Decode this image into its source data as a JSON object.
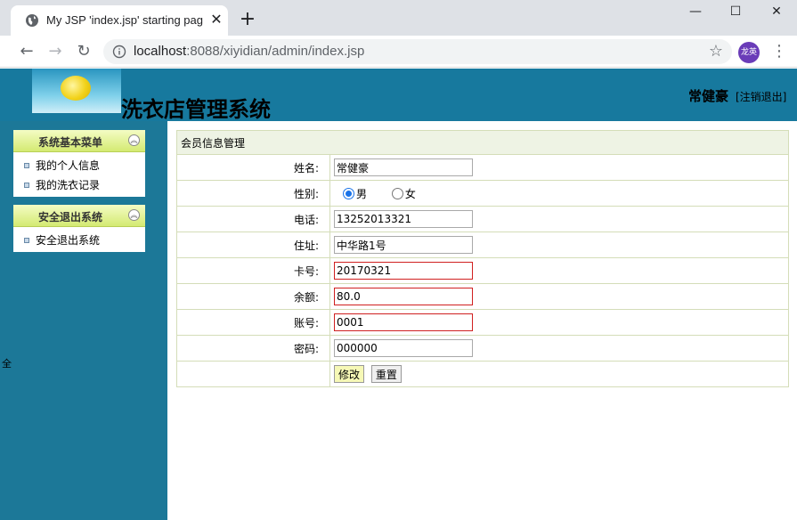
{
  "browser": {
    "tab_title": "My JSP 'index.jsp' starting page",
    "tab_close": "✕",
    "new_tab": "+",
    "url_host": "localhost",
    "url_rest": ":8088/xiyidian/admin/index.jsp",
    "profile": "龙英",
    "window_minimize": "—",
    "window_maximize": "☐",
    "window_close": "✕",
    "back": "←",
    "forward": "→",
    "reload": "↻",
    "bookmark": "☆",
    "menu": "⋮"
  },
  "header": {
    "system_title": "洗衣店管理系统",
    "user_name": "常健豪",
    "logout": "[注销退出]"
  },
  "sidebar": {
    "panels": [
      {
        "title": "系统基本菜单",
        "items": [
          "我的个人信息",
          "我的洗衣记录"
        ]
      },
      {
        "title": "安全退出系统",
        "items": [
          "安全退出系统"
        ]
      }
    ],
    "collapse_glyph": "︽",
    "fragment": "全"
  },
  "form": {
    "caption": "会员信息管理",
    "fields": {
      "name": {
        "label": "姓名:",
        "value": "常健豪"
      },
      "gender": {
        "label": "性别:",
        "options": [
          "男",
          "女"
        ],
        "selected": "男"
      },
      "phone": {
        "label": "电话:",
        "value": "13252013321"
      },
      "address": {
        "label": "住址:",
        "value": "中华路1号"
      },
      "card": {
        "label": "卡号:",
        "value": "20170321"
      },
      "balance": {
        "label": "余额:",
        "value": "80.0"
      },
      "account": {
        "label": "账号:",
        "value": "0001"
      },
      "password": {
        "label": "密码:",
        "value": "000000"
      }
    },
    "submit_label": "修改",
    "reset_label": "重置"
  },
  "colors": {
    "header_bg": "#17799e",
    "sidebar_bg": "#1c7898",
    "panel_head": "#d4ea72",
    "required_border": "#d02020"
  }
}
